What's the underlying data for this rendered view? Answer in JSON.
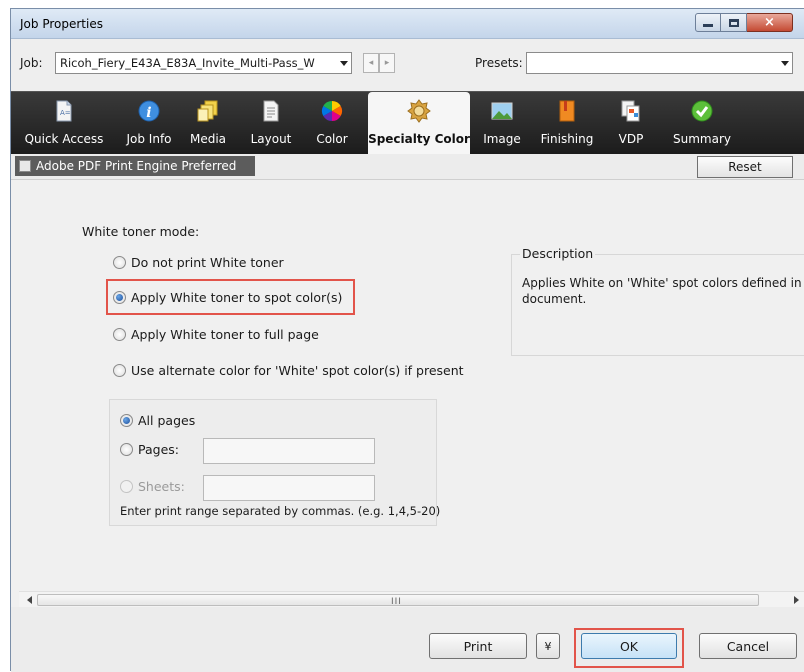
{
  "window": {
    "title": "Job Properties",
    "minimize": "minimize",
    "maximize": "maximize",
    "close": "×"
  },
  "job_row": {
    "job_label": "Job:",
    "job_value": "Ricoh_Fiery_E43A_E83A_Invite_Multi-Pass_W",
    "prev_glyph": "◂",
    "next_glyph": "▸",
    "presets_label": "Presets:",
    "presets_value": ""
  },
  "tabs": [
    {
      "label": "Quick Access",
      "icon": "document-icon",
      "active": false
    },
    {
      "label": "Job Info",
      "icon": "info-icon",
      "active": false
    },
    {
      "label": "Media",
      "icon": "paper-stack-icon",
      "active": false
    },
    {
      "label": "Layout",
      "icon": "page-icon",
      "active": false
    },
    {
      "label": "Color",
      "icon": "color-wheel-icon",
      "active": false
    },
    {
      "label": "Specialty Color",
      "icon": "specialty-color-icon",
      "active": true
    },
    {
      "label": "Image",
      "icon": "image-icon",
      "active": false
    },
    {
      "label": "Finishing",
      "icon": "booklet-icon",
      "active": false
    },
    {
      "label": "VDP",
      "icon": "vdp-icon",
      "active": false
    },
    {
      "label": "Summary",
      "icon": "checkmark-icon",
      "active": false
    }
  ],
  "strip": {
    "pdf_engine_label": "Adobe PDF Print Engine Preferred",
    "pdf_engine_checked": false,
    "reset_label": "Reset"
  },
  "white_toner": {
    "heading": "White toner mode:",
    "options": [
      {
        "label": "Do not print White toner",
        "selected": false
      },
      {
        "label": "Apply White toner to spot color(s)",
        "selected": true
      },
      {
        "label": "Apply White toner to full page",
        "selected": false
      },
      {
        "label": "Use alternate color for 'White' spot color(s) if present",
        "selected": false
      }
    ]
  },
  "page_range": {
    "all_pages_label": "All pages",
    "pages_label": "Pages:",
    "pages_value": "",
    "sheets_label": "Sheets:",
    "sheets_value": "",
    "hint": "Enter print range separated by commas. (e.g. 1,4,5-20)"
  },
  "description": {
    "legend": "Description",
    "text": "Applies White on 'White' spot colors defined in document."
  },
  "scrollbar": {
    "grip": "III"
  },
  "footer": {
    "print_label": "Print",
    "more_glyph": "¥",
    "ok_label": "OK",
    "cancel_label": "Cancel"
  },
  "colors": {
    "highlight": "#e2544a",
    "toolbar_bg": "#262626",
    "window_bg": "#f0f0f0"
  }
}
